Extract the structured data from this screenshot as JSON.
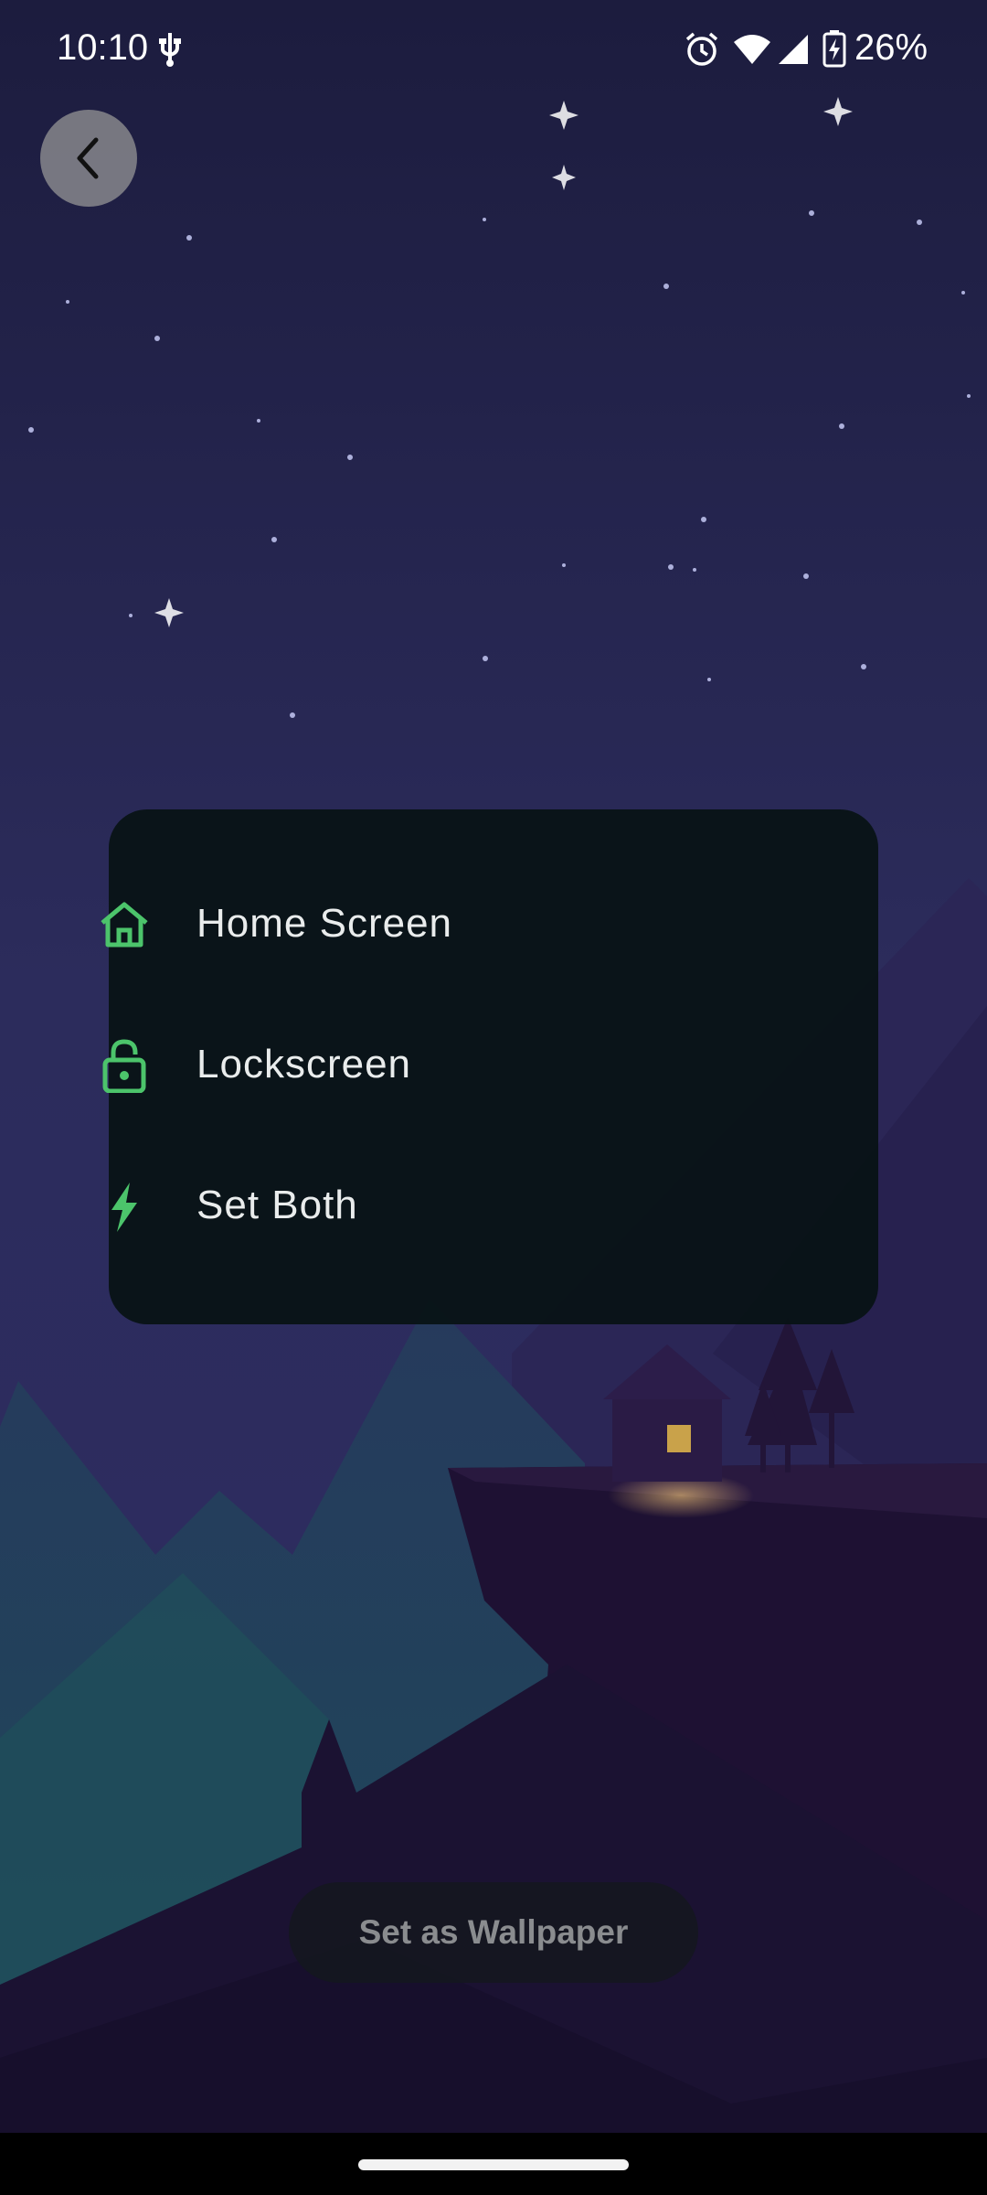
{
  "status_bar": {
    "time": "10:10",
    "battery_percent": "26%",
    "icons": [
      "usb-icon",
      "alarm-icon",
      "wifi-icon",
      "signal-icon",
      "battery-charging-icon"
    ]
  },
  "back_button": {
    "icon": "chevron-left-icon"
  },
  "menu": {
    "items": [
      {
        "label": "Home Screen",
        "icon": "home-icon"
      },
      {
        "label": "Lockscreen",
        "icon": "lock-open-icon"
      },
      {
        "label": "Set Both",
        "icon": "lightning-icon"
      }
    ],
    "accent_color": "#4cc46b"
  },
  "set_wallpaper_button": {
    "label": "Set as Wallpaper"
  }
}
